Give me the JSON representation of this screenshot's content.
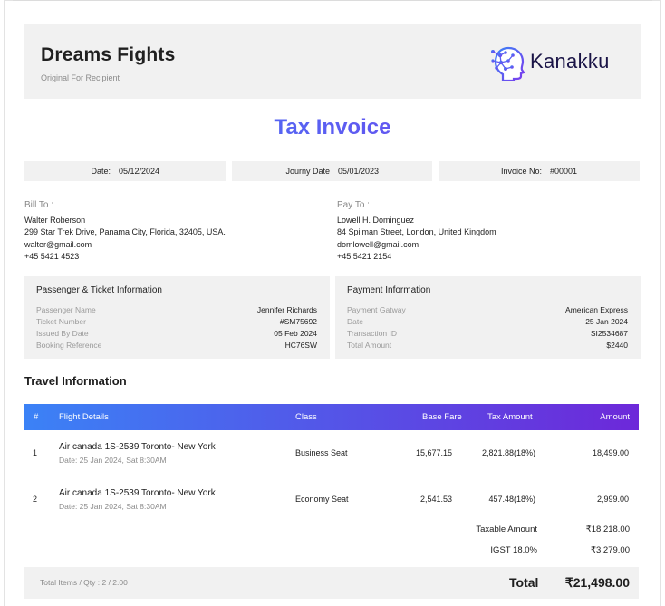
{
  "header": {
    "company": "Dreams Fights",
    "subtitle": "Original For Recipient",
    "logo_text": "Kanakku"
  },
  "title": "Tax Invoice",
  "meta": {
    "date_label": "Date:",
    "date_value": "05/12/2024",
    "journey_label": "Journy Date",
    "journey_value": "05/01/2023",
    "invoice_label": "Invoice No:",
    "invoice_value": "#00001"
  },
  "bill_to": {
    "heading": "Bill To :",
    "name": "Walter Roberson",
    "address": "299 Star Trek Drive, Panama City, Florida, 32405, USA.",
    "email": "walter@gmail.com",
    "phone": "+45 5421 4523"
  },
  "pay_to": {
    "heading": "Pay To :",
    "name": "Lowell H. Dominguez",
    "address": "84 Spilman Street, London, United Kingdom",
    "email": "domlowell@gmail.com",
    "phone": "+45 5421 2154"
  },
  "passenger_panel": {
    "heading": "Passenger & Ticket Information",
    "rows": [
      {
        "label": "Passenger Name",
        "value": "Jennifer Richards"
      },
      {
        "label": "Ticket Number",
        "value": "#SM75692"
      },
      {
        "label": "Issued By Date",
        "value": "05 Feb 2024"
      },
      {
        "label": "Booking Reference",
        "value": "HC76SW"
      }
    ]
  },
  "payment_panel": {
    "heading": "Payment Information",
    "rows": [
      {
        "label": "Payment Gatway",
        "value": "American Express"
      },
      {
        "label": "Date",
        "value": "25 Jan 2024"
      },
      {
        "label": "Transaction ID",
        "value": "SI2534687"
      },
      {
        "label": "Total Amount",
        "value": "$2440"
      }
    ]
  },
  "travel": {
    "heading": "Travel Information",
    "columns": {
      "num": "#",
      "details": "Flight Details",
      "class": "Class",
      "base": "Base Fare",
      "tax": "Tax Amount",
      "amount": "Amount"
    },
    "rows": [
      {
        "num": "1",
        "flight": "Air canada 1S-2539 Toronto- New York",
        "date": "Date: 25 Jan 2024, Sat 8:30AM",
        "class": "Business Seat",
        "base": "15,677.15",
        "tax": "2,821.88(18%)",
        "amount": "18,499.00"
      },
      {
        "num": "2",
        "flight": "Air canada 1S-2539 Toronto- New York",
        "date": "Date: 25 Jan 2024, Sat 8:30AM",
        "class": "Economy Seat",
        "base": "2,541.53",
        "tax": "457.48(18%)",
        "amount": "2,999.00"
      }
    ]
  },
  "summary": {
    "taxable_label": "Taxable Amount",
    "taxable_value": "₹18,218.00",
    "igst_label": "IGST 18.0%",
    "igst_value": "₹3,279.00",
    "items_text": "Total Items / Qty : 2 / 2.00",
    "total_label": "Total",
    "total_value": "₹21,498.00"
  }
}
